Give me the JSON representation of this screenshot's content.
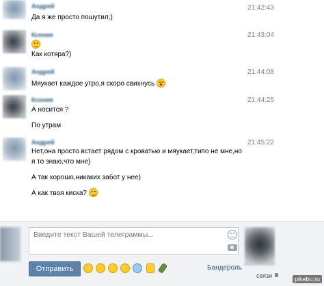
{
  "messages": [
    {
      "name": "Андрей",
      "time": "21:42:43",
      "lines": [
        "Да я же просто пошутил;)"
      ]
    },
    {
      "name": "Ксения",
      "time": "21:43:04",
      "lines": [
        "",
        "Как котяра?)"
      ]
    },
    {
      "name": "Андрей",
      "time": "21:44:08",
      "lines": [
        "Мяукает каждое утро,я скоро свихнусь"
      ]
    },
    {
      "name": "Ксения",
      "time": "21:44:25",
      "lines": [
        "А носится ?",
        "По утрам"
      ]
    },
    {
      "name": "Андрей",
      "time": "21:45:22",
      "lines": [
        "Нет,она просто встает рядом с кроватью и мяукает,типо не мне,но я то знаю,что мне)",
        "А так хорошо,никаких забот у нее)",
        "А как твоя киска?"
      ]
    }
  ],
  "composer": {
    "placeholder": "Введите текст Вашей телеграммы...",
    "send_label": "Отправить",
    "banderol_label": "Бандероль",
    "svyazi_label": "связи",
    "emoji_icons": [
      "smile-icon",
      "surprised-icon",
      "grin-icon",
      "cool-icon",
      "scared-icon",
      "thumbs-up-icon",
      "bottle-icon"
    ]
  },
  "watermark": "pikabu.ru",
  "colors": {
    "send_button": "#5e82a8",
    "link": "#2b587a",
    "time": "#808080",
    "panel": "#f0f2f5"
  }
}
